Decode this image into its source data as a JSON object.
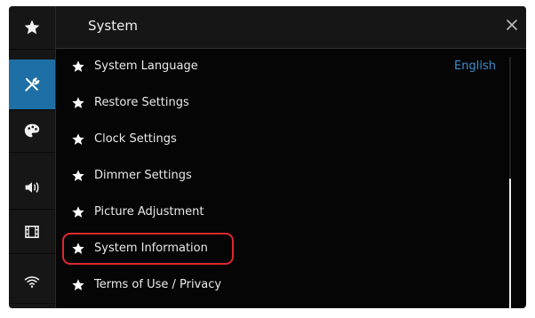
{
  "header": {
    "title": "System"
  },
  "sidebar": {
    "items": [
      {
        "name": "favorites",
        "icon": "star-icon",
        "active": false
      },
      {
        "name": "system",
        "icon": "tools-icon",
        "active": true
      },
      {
        "name": "theme",
        "icon": "palette-icon",
        "active": false
      },
      {
        "name": "audio",
        "icon": "speaker-icon",
        "active": false
      },
      {
        "name": "video",
        "icon": "film-icon",
        "active": false
      },
      {
        "name": "wireless",
        "icon": "wifi-icon",
        "active": false
      }
    ]
  },
  "menu": {
    "items": [
      {
        "label": "System Language",
        "value": "English"
      },
      {
        "label": "Restore Settings"
      },
      {
        "label": "Clock Settings"
      },
      {
        "label": "Dimmer Settings"
      },
      {
        "label": "Picture Adjustment"
      },
      {
        "label": "System Information",
        "highlighted": true
      },
      {
        "label": "Terms of Use / Privacy"
      }
    ]
  },
  "colors": {
    "accent": "#1e6fa6",
    "value_text": "#3a8fd0",
    "highlight": "#e0282e"
  }
}
